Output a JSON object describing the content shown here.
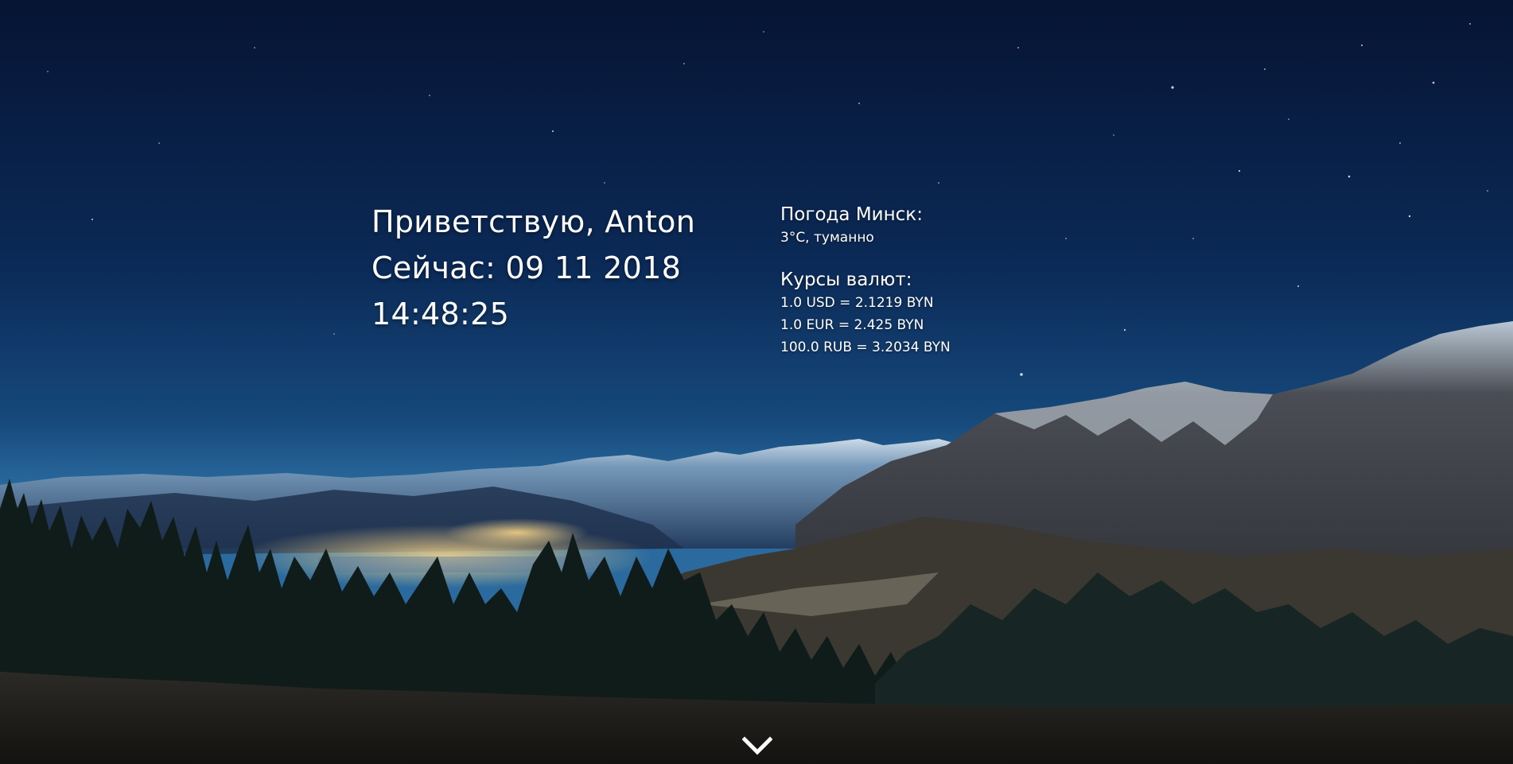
{
  "greeting": {
    "hello": "Приветствую, Anton",
    "date": "Сейчас: 09 11 2018",
    "time": "14:48:25"
  },
  "weather": {
    "title": "Погода Минск:",
    "value": "3°C, туманно"
  },
  "currency": {
    "title": "Курсы валют:",
    "rates": [
      "1.0 USD = 2.1219 BYN",
      "1.0 EUR = 2.425 BYN",
      "100.0 RUB = 3.2034 BYN"
    ]
  },
  "controls": {
    "scroll_icon": "chevron-down-icon"
  },
  "colors": {
    "text": "#ffffff",
    "sky_top": "#061433",
    "sky_horizon": "#1c5a8f"
  }
}
